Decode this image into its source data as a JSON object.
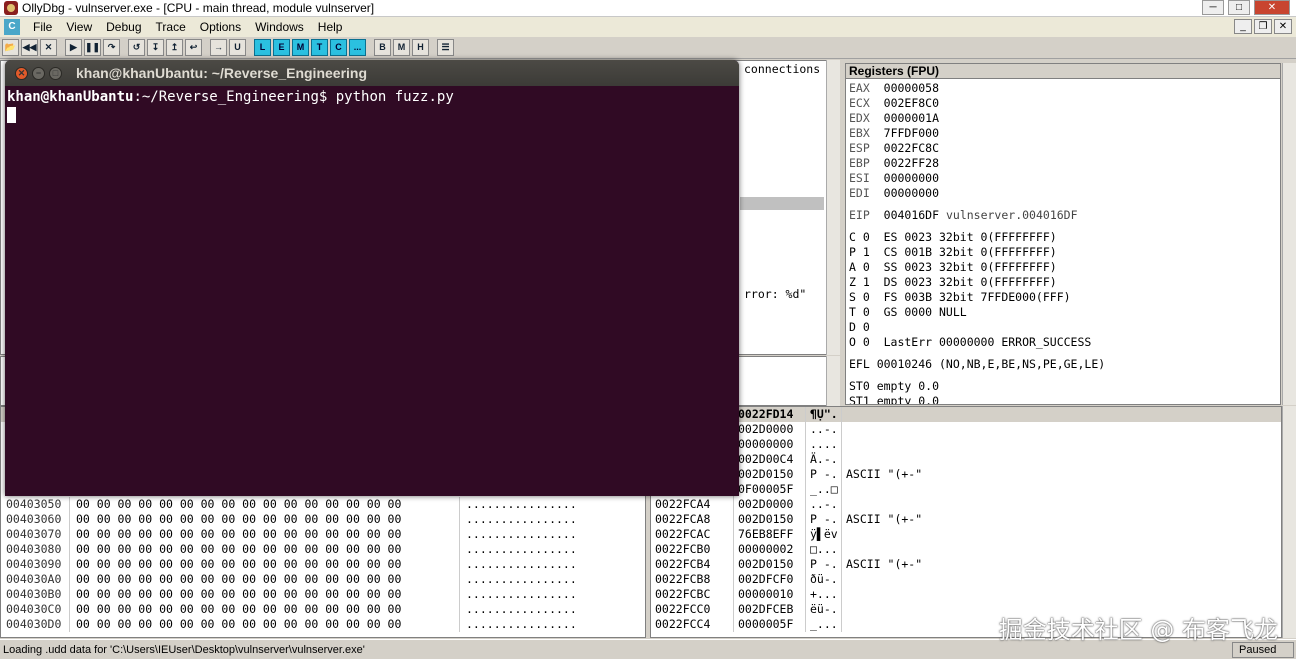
{
  "window": {
    "title": "OllyDbg - vulnserver.exe - [CPU - main thread, module vulnserver]"
  },
  "menu": {
    "mdi_icon": "C",
    "items": [
      "File",
      "View",
      "Debug",
      "Trace",
      "Options",
      "Windows",
      "Help"
    ]
  },
  "toolbar": {
    "buttons": [
      "open-icon",
      "rewind-icon",
      "close-icon",
      "run-icon",
      "pause-icon",
      "step-into-icon",
      "step-over-icon",
      "trace-into-icon",
      "trace-over-icon",
      "execute-till-return-icon",
      "goto-icon",
      "user-icon"
    ],
    "window_letters": [
      "L",
      "E",
      "M",
      "T",
      "C",
      "..."
    ],
    "extra_letters": [
      "B",
      "M",
      "H"
    ]
  },
  "terminal": {
    "title": "khan@khanUbantu: ~/Reverse_Engineering",
    "prompt_user": "khan@khanUbantu",
    "prompt_path": ":~/Reverse_Engineering$",
    "command": " python fuzz.py"
  },
  "disasm_peek": {
    "line1": "connections",
    "line2": "rror: %d\""
  },
  "registers": {
    "header": "Registers (FPU)",
    "gp": [
      {
        "name": "EAX",
        "val": "00000058",
        "note": ""
      },
      {
        "name": "ECX",
        "val": "002EF8C0",
        "note": ""
      },
      {
        "name": "EDX",
        "val": "0000001A",
        "note": ""
      },
      {
        "name": "EBX",
        "val": "7FFDF000",
        "note": ""
      },
      {
        "name": "ESP",
        "val": "0022FC8C",
        "note": ""
      },
      {
        "name": "EBP",
        "val": "0022FF28",
        "note": ""
      },
      {
        "name": "ESI",
        "val": "00000000",
        "note": ""
      },
      {
        "name": "EDI",
        "val": "00000000",
        "note": ""
      }
    ],
    "eip": {
      "name": "EIP",
      "val": "004016DF",
      "note": "vulnserver.004016DF"
    },
    "flags": [
      "C 0  ES 0023 32bit 0(FFFFFFFF)",
      "P 1  CS 001B 32bit 0(FFFFFFFF)",
      "A 0  SS 0023 32bit 0(FFFFFFFF)",
      "Z 1  DS 0023 32bit 0(FFFFFFFF)",
      "S 0  FS 003B 32bit 7FFDE000(FFF)",
      "T 0  GS 0000 NULL",
      "D 0",
      "O 0  LastErr 00000000 ERROR_SUCCESS"
    ],
    "efl": "EFL 00010246 (NO,NB,E,BE,NS,PE,GE,LE)",
    "fpu": [
      "ST0 empty 0.0",
      "ST1 empty 0.0"
    ]
  },
  "dump": {
    "rows": [
      {
        "addr": "00403050",
        "hex": "00 00 00 00 00 00 00 00 00 00 00 00 00 00 00 00",
        "ascii": "................"
      },
      {
        "addr": "00403060",
        "hex": "00 00 00 00 00 00 00 00 00 00 00 00 00 00 00 00",
        "ascii": "................"
      },
      {
        "addr": "00403070",
        "hex": "00 00 00 00 00 00 00 00 00 00 00 00 00 00 00 00",
        "ascii": "................"
      },
      {
        "addr": "00403080",
        "hex": "00 00 00 00 00 00 00 00 00 00 00 00 00 00 00 00",
        "ascii": "................"
      },
      {
        "addr": "00403090",
        "hex": "00 00 00 00 00 00 00 00 00 00 00 00 00 00 00 00",
        "ascii": "................"
      },
      {
        "addr": "004030A0",
        "hex": "00 00 00 00 00 00 00 00 00 00 00 00 00 00 00 00",
        "ascii": "................"
      },
      {
        "addr": "004030B0",
        "hex": "00 00 00 00 00 00 00 00 00 00 00 00 00 00 00 00",
        "ascii": "................"
      },
      {
        "addr": "004030C0",
        "hex": "00 00 00 00 00 00 00 00 00 00 00 00 00 00 00 00",
        "ascii": "................"
      },
      {
        "addr": "004030D0",
        "hex": "00 00 00 00 00 00 00 00 00 00 00 00 00 00 00 00",
        "ascii": "................"
      }
    ]
  },
  "stack": {
    "header": {
      "addr": "",
      "val": "0022FD14",
      "chars": "¶Ụ\".",
      "cmt": ""
    },
    "rows": [
      {
        "addr": "",
        "val": "002D0000",
        "chars": "..-.",
        "cmt": ""
      },
      {
        "addr": "",
        "val": "00000000",
        "chars": "....",
        "cmt": ""
      },
      {
        "addr": "",
        "val": "002D00C4",
        "chars": "Ä.-.",
        "cmt": ""
      },
      {
        "addr": "",
        "val": "002D0150",
        "chars": "P -.",
        "cmt": "ASCII \"(+-\""
      },
      {
        "addr": "",
        "val": "0F00005F",
        "chars": "_..□",
        "cmt": ""
      },
      {
        "addr": "0022FCA4",
        "val": "002D0000",
        "chars": "..-.",
        "cmt": ""
      },
      {
        "addr": "0022FCA8",
        "val": "002D0150",
        "chars": "P -.",
        "cmt": "ASCII \"(+-\""
      },
      {
        "addr": "0022FCAC",
        "val": "76EB8EFF",
        "chars": "ÿ▌ëv",
        "cmt": ""
      },
      {
        "addr": "0022FCB0",
        "val": "00000002",
        "chars": "□...",
        "cmt": ""
      },
      {
        "addr": "0022FCB4",
        "val": "002D0150",
        "chars": "P -.",
        "cmt": "ASCII \"(+-\""
      },
      {
        "addr": "0022FCB8",
        "val": "002DFCF0",
        "chars": "ðü-.",
        "cmt": ""
      },
      {
        "addr": "0022FCBC",
        "val": "00000010",
        "chars": "+...",
        "cmt": ""
      },
      {
        "addr": "0022FCC0",
        "val": "002DFCEB",
        "chars": "ëü-.",
        "cmt": ""
      },
      {
        "addr": "0022FCC4",
        "val": "0000005F",
        "chars": "_...",
        "cmt": ""
      }
    ]
  },
  "status": {
    "message": "Loading .udd data for 'C:\\Users\\IEUser\\Desktop\\vulnserver\\vulnserver.exe'",
    "state": "Paused"
  },
  "watermark": "掘金技术社区 @ 布客飞龙"
}
